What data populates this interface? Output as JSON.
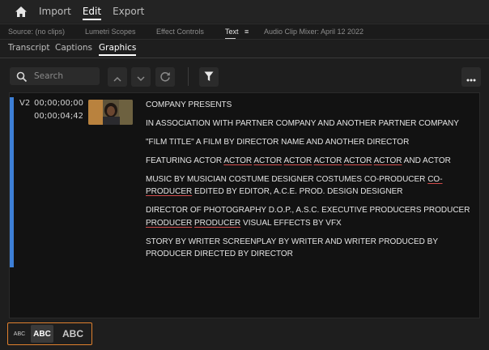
{
  "menu": {
    "home_icon": "home-icon",
    "items": [
      "Import",
      "Edit",
      "Export"
    ],
    "active": "Edit"
  },
  "panel_tabs": {
    "source": "Source: (no clips)",
    "lumetri": "Lumetri Scopes",
    "effect_controls": "Effect Controls",
    "text": "Text",
    "audio_mixer": "Audio Clip Mixer: April 12 2022"
  },
  "sub_tabs": [
    "Transcript",
    "Captions",
    "Graphics"
  ],
  "sub_tab_active": "Graphics",
  "toolbar": {
    "search_placeholder": "Search",
    "search_value": ""
  },
  "clip": {
    "track": "V2",
    "in": "00;00;00;00",
    "out": "00;00;04;42",
    "thumbnail": "film-still-thumbnail",
    "lines": [
      [
        {
          "t": "COMPANY PRESENTS"
        }
      ],
      [
        {
          "t": "IN ASSOCIATION WITH PARTNER COMPANY AND ANOTHER PARTNER COMPANY"
        }
      ],
      [
        {
          "t": "\"FILM TITLE\" A FILM BY DIRECTOR NAME AND ANOTHER DIRECTOR"
        }
      ],
      [
        {
          "t": "FEATURING ACTOR "
        },
        {
          "t": "ACTOR",
          "u": true
        },
        {
          "t": " "
        },
        {
          "t": "ACTOR",
          "u": true
        },
        {
          "t": " "
        },
        {
          "t": "ACTOR",
          "u": true
        },
        {
          "t": " "
        },
        {
          "t": "ACTOR",
          "u": true
        },
        {
          "t": " "
        },
        {
          "t": "ACTOR",
          "u": true
        },
        {
          "t": " "
        },
        {
          "t": "ACTOR",
          "u": true
        },
        {
          "t": " AND ACTOR"
        }
      ],
      [
        {
          "t": "MUSIC BY MUSICIAN COSTUME DESIGNER COSTUMES CO-PRODUCER "
        },
        {
          "t": "CO-PRODUCER",
          "u": true
        },
        {
          "t": " EDITED BY EDITOR, A.C.E. PROD. DESIGN DESIGNER"
        }
      ],
      [
        {
          "t": "DIRECTOR OF PHOTOGRAPHY D.O.P., A.S.C. EXECUTIVE PRODUCERS PRODUCER "
        },
        {
          "t": "PRODUCER",
          "u": true
        },
        {
          "t": " "
        },
        {
          "t": "PRODUCER",
          "u": true
        },
        {
          "t": " VISUAL EFFECTS BY VFX"
        }
      ],
      [
        {
          "t": "STORY BY WRITER SCREENPLAY BY WRITER AND WRITER PRODUCED BY PRODUCER DIRECTED BY DIRECTOR"
        }
      ]
    ]
  },
  "text_size": {
    "options": [
      "ABC",
      "ABC",
      "ABC"
    ],
    "selected_index": 1
  },
  "colors": {
    "accent_track": "#3d7fd6",
    "selector_outline": "#e0802e",
    "spell_underline": "#d04a4a"
  }
}
